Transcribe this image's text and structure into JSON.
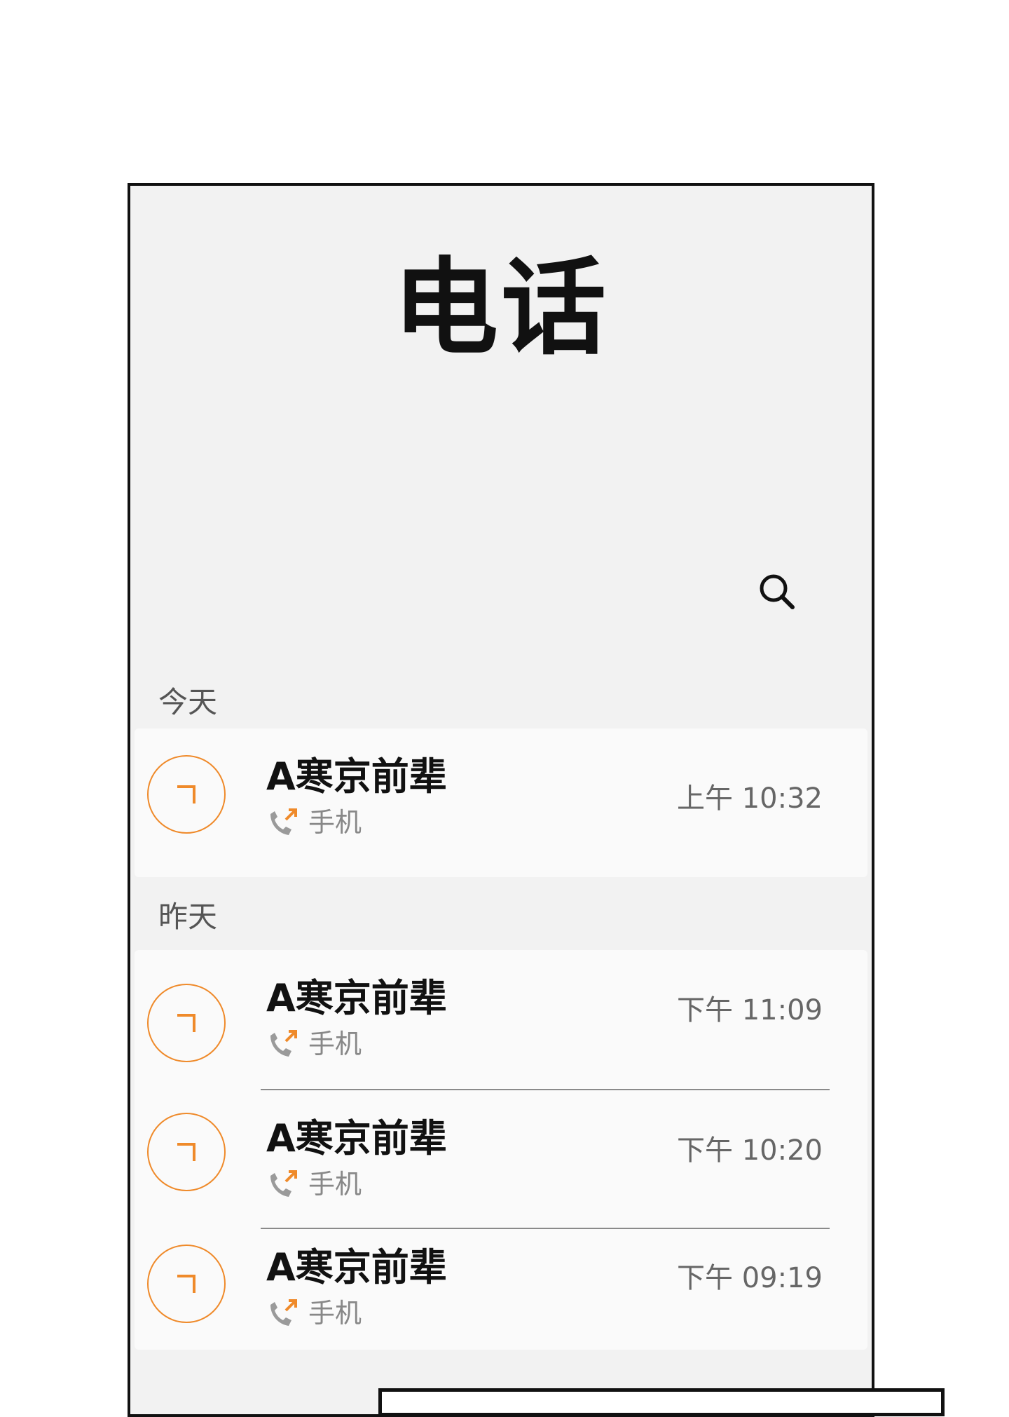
{
  "app": {
    "title": "电话"
  },
  "toolbar": {
    "search_icon": "search-icon",
    "more_icon": "more-vertical-icon"
  },
  "sections": [
    {
      "label": "今天",
      "calls": [
        {
          "name": "A寒京前辈",
          "type": "手机",
          "time": "上午 10:32",
          "direction": "outgoing"
        }
      ]
    },
    {
      "label": "昨天",
      "calls": [
        {
          "name": "A寒京前辈",
          "type": "手机",
          "time": "下午 11:09",
          "direction": "outgoing"
        },
        {
          "name": "A寒京前辈",
          "type": "手机",
          "time": "下午 10:20",
          "direction": "outgoing"
        },
        {
          "name": "A寒京前辈",
          "type": "手机",
          "time": "下午 09:19",
          "direction": "outgoing"
        }
      ]
    }
  ],
  "colors": {
    "accent": "#ef8a2a",
    "background": "#f2f2f2",
    "card": "#fafafa"
  }
}
